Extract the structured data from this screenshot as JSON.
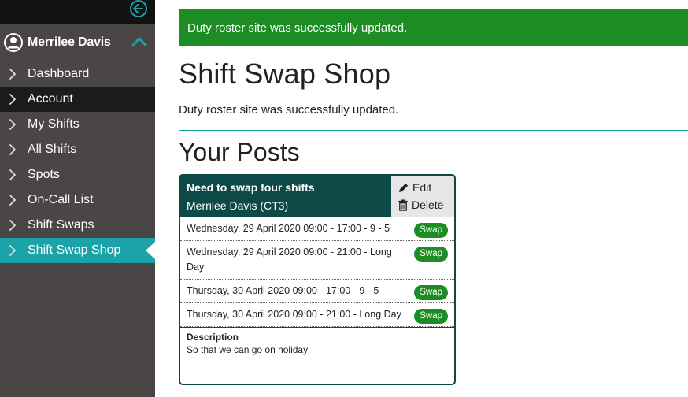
{
  "sidebar": {
    "collapse_icon": "arrow-left-circle-icon",
    "user": {
      "name": "Merrilee Davis",
      "avatar_icon": "user-circle-icon",
      "toggle_icon": "chevron-up-icon"
    },
    "items": [
      {
        "label": "Dashboard",
        "state": "normal"
      },
      {
        "label": "Account",
        "state": "dark"
      },
      {
        "label": "My Shifts",
        "state": "normal"
      },
      {
        "label": "All Shifts",
        "state": "normal"
      },
      {
        "label": "Spots",
        "state": "normal"
      },
      {
        "label": "On-Call List",
        "state": "normal"
      },
      {
        "label": "Shift Swaps",
        "state": "normal"
      },
      {
        "label": "Shift Swap Shop",
        "state": "active"
      }
    ]
  },
  "alert": {
    "text": "Duty roster site was successfully updated."
  },
  "page": {
    "title": "Shift Swap Shop",
    "flash": "Duty roster site was successfully updated.",
    "section_title": "Your Posts"
  },
  "post": {
    "title": "Need to swap four shifts",
    "author": "Merrilee Davis (CT3)",
    "edit_label": "Edit",
    "delete_label": "Delete",
    "shifts": [
      {
        "text": "Wednesday, 29 April 2020 09:00 - 17:00 - 9 - 5",
        "swap_label": "Swap"
      },
      {
        "text": "Wednesday, 29 April 2020 09:00 - 21:00 - Long Day",
        "swap_label": "Swap"
      },
      {
        "text": "Thursday, 30 April 2020 09:00 - 17:00 - 9 - 5",
        "swap_label": "Swap"
      },
      {
        "text": "Thursday, 30 April 2020 09:00 - 21:00 - Long Day",
        "swap_label": "Swap"
      }
    ],
    "description_label": "Description",
    "description": "So that we can go on holiday"
  },
  "colors": {
    "teal": "#1aa3a8",
    "dark_teal": "#0d4a47",
    "green": "#1e8c25",
    "sidebar_bg": "#4a4646"
  }
}
